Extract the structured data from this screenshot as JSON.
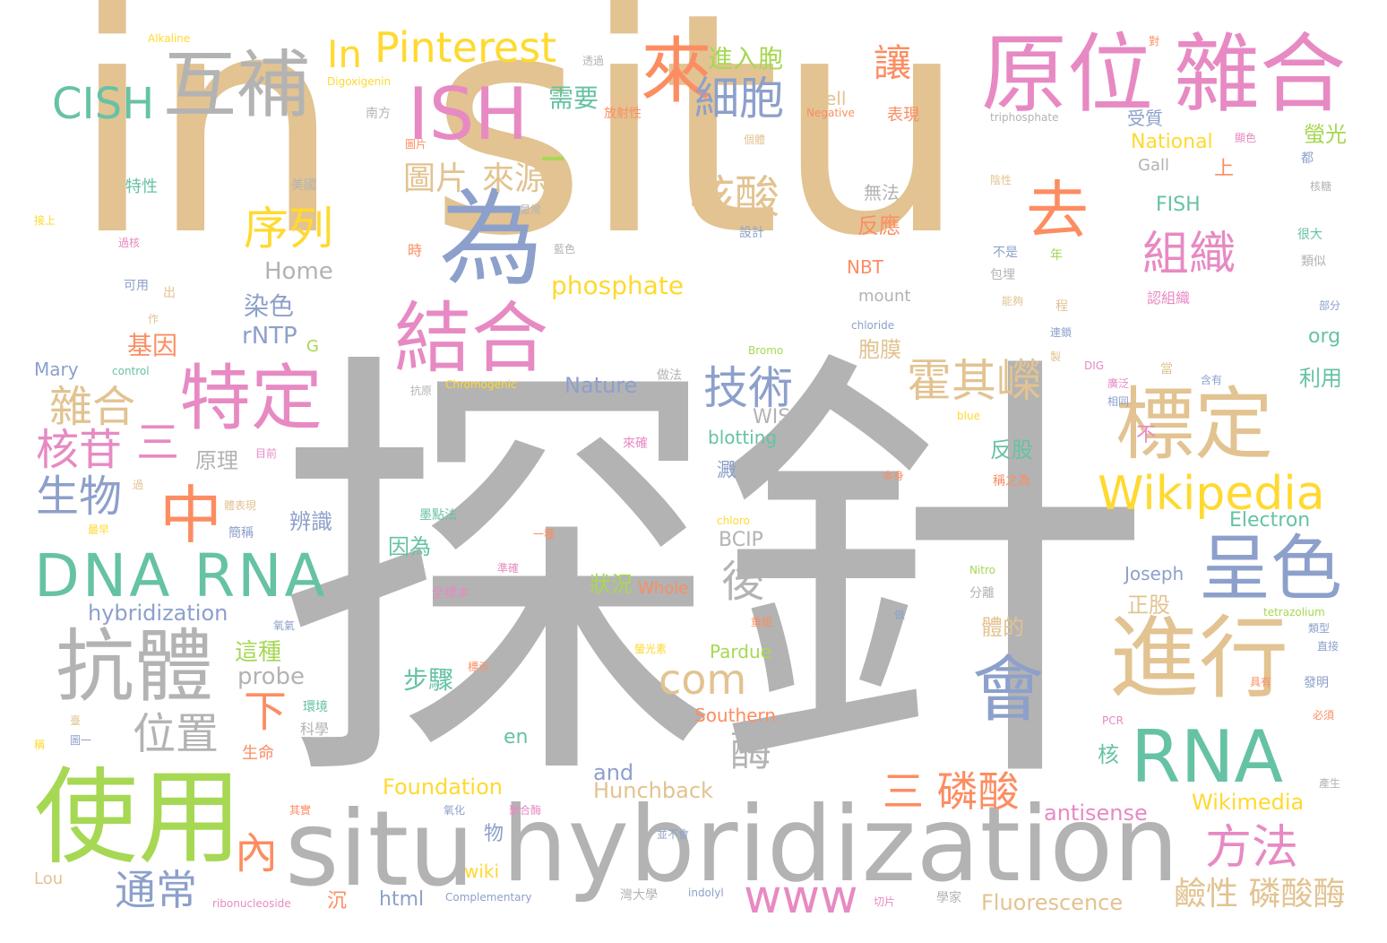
{
  "palette": {
    "tan": "#e2c391",
    "grey": "#b3b3b3",
    "pink": "#e78ac3",
    "green": "#66c2a5",
    "orange": "#fc8d62",
    "blue": "#8da0cb",
    "yellow": "#ffd92f",
    "lime": "#a6d854"
  },
  "words": [
    {
      "text": "in situ",
      "color": "#e2c391"
    },
    {
      "text": "探針",
      "color": "#b3b3b3"
    },
    {
      "text": "原位",
      "color": "#e78ac3"
    },
    {
      "text": "雜合",
      "color": "#e78ac3"
    },
    {
      "text": "互補",
      "color": "#b3b3b3"
    },
    {
      "text": "ISH",
      "color": "#e78ac3"
    },
    {
      "text": "為",
      "color": "#8da0cb"
    },
    {
      "text": "來",
      "color": "#fc8d62"
    },
    {
      "text": "結合",
      "color": "#e78ac3"
    },
    {
      "text": "特定",
      "color": "#e78ac3"
    },
    {
      "text": "中",
      "color": "#fc8d62"
    },
    {
      "text": "DNA RNA",
      "color": "#66c2a5"
    },
    {
      "text": "抗體",
      "color": "#b3b3b3"
    },
    {
      "text": "使用",
      "color": "#a6d854"
    },
    {
      "text": "situ",
      "color": "#b3b3b3"
    },
    {
      "text": "hybridization",
      "color": "#b3b3b3"
    },
    {
      "text": "進行",
      "color": "#e2c391"
    },
    {
      "text": "標定",
      "color": "#e2c391"
    },
    {
      "text": "呈色",
      "color": "#8da0cb"
    },
    {
      "text": "RNA",
      "color": "#66c2a5"
    },
    {
      "text": "會",
      "color": "#8da0cb"
    },
    {
      "text": "Wikipedia",
      "color": "#ffd92f"
    },
    {
      "text": "Pinterest",
      "color": "#ffd92f"
    },
    {
      "text": "CISH",
      "color": "#66c2a5"
    },
    {
      "text": "細胞",
      "color": "#8da0cb"
    },
    {
      "text": "核酸",
      "color": "#e2c391"
    },
    {
      "text": "組織",
      "color": "#e78ac3"
    },
    {
      "text": "去",
      "color": "#fc8d62"
    },
    {
      "text": "序列",
      "color": "#ffd92f"
    },
    {
      "text": "圖片",
      "color": "#e2c391"
    },
    {
      "text": "來源",
      "color": "#e2c391"
    },
    {
      "text": "技術",
      "color": "#8da0cb"
    },
    {
      "text": "霍其嶸",
      "color": "#e2c391"
    },
    {
      "text": "雜合",
      "color": "#e2c391"
    },
    {
      "text": "核苷",
      "color": "#e78ac3"
    },
    {
      "text": "生物",
      "color": "#8da0cb"
    },
    {
      "text": "位置",
      "color": "#b3b3b3"
    },
    {
      "text": "com",
      "color": "#e2c391"
    },
    {
      "text": "方法",
      "color": "#e78ac3"
    },
    {
      "text": "三 磷酸",
      "color": "#fc8d62"
    },
    {
      "text": "通常",
      "color": "#8da0cb"
    },
    {
      "text": "www",
      "color": "#e78ac3"
    },
    {
      "text": "鹼性 磷酸酶",
      "color": "#e2c391"
    },
    {
      "text": "後",
      "color": "#b3b3b3"
    },
    {
      "text": "酶",
      "color": "#b3b3b3"
    },
    {
      "text": "In",
      "color": "#ffd92f"
    },
    {
      "text": "讓",
      "color": "#fc8d62"
    },
    {
      "text": "需要",
      "color": "#66c2a5"
    },
    {
      "text": "進入胞",
      "color": "#a6d854"
    },
    {
      "text": "phosphate",
      "color": "#ffd92f"
    },
    {
      "text": "Home",
      "color": "#b3b3b3"
    },
    {
      "text": "染色",
      "color": "#8da0cb"
    },
    {
      "text": "rNTP",
      "color": "#8da0cb"
    },
    {
      "text": "基因",
      "color": "#fc8d62"
    },
    {
      "text": "三",
      "color": "#e78ac3"
    },
    {
      "text": "原理",
      "color": "#b3b3b3"
    },
    {
      "text": "下",
      "color": "#fc8d62"
    },
    {
      "text": "內",
      "color": "#fc8d62"
    },
    {
      "text": "probe",
      "color": "#b3b3b3"
    },
    {
      "text": "這種",
      "color": "#a6d854"
    },
    {
      "text": "步驟",
      "color": "#66c2a5"
    },
    {
      "text": "Foundation",
      "color": "#ffd92f"
    },
    {
      "text": "wiki",
      "color": "#ffd92f"
    },
    {
      "text": "html",
      "color": "#8da0cb"
    },
    {
      "text": "Fluorescence",
      "color": "#e2c391"
    },
    {
      "text": "Wikimedia",
      "color": "#ffd92f"
    },
    {
      "text": "antisense",
      "color": "#e78ac3"
    },
    {
      "text": "Southern",
      "color": "#fc8d62"
    },
    {
      "text": "Hunchback",
      "color": "#e2c391"
    },
    {
      "text": "and",
      "color": "#8da0cb"
    },
    {
      "text": "en",
      "color": "#66c2a5"
    },
    {
      "text": "hybridization",
      "color": "#8da0cb"
    },
    {
      "text": "Mary",
      "color": "#8da0cb"
    },
    {
      "text": "Nature",
      "color": "#8da0cb"
    },
    {
      "text": "WISH",
      "color": "#b3b3b3"
    },
    {
      "text": "blotting",
      "color": "#66c2a5"
    },
    {
      "text": "BCIP",
      "color": "#b3b3b3"
    },
    {
      "text": "Joseph",
      "color": "#8da0cb"
    },
    {
      "text": "Pardue",
      "color": "#a6d854"
    },
    {
      "text": "Electron",
      "color": "#66c2a5"
    },
    {
      "text": "National",
      "color": "#ffd92f"
    },
    {
      "text": "Gall",
      "color": "#b3b3b3"
    },
    {
      "text": "FISH",
      "color": "#66c2a5"
    },
    {
      "text": "NBT",
      "color": "#fc8d62"
    },
    {
      "text": "mount",
      "color": "#b3b3b3"
    },
    {
      "text": "cell",
      "color": "#e2c391"
    },
    {
      "text": "org",
      "color": "#66c2a5"
    },
    {
      "text": "胞膜",
      "color": "#e2c391"
    },
    {
      "text": "反應",
      "color": "#fc8d62"
    },
    {
      "text": "無法",
      "color": "#b3b3b3"
    },
    {
      "text": "反股",
      "color": "#66c2a5"
    },
    {
      "text": "正股",
      "color": "#e2c391"
    },
    {
      "text": "體的",
      "color": "#e2c391"
    },
    {
      "text": "辨識",
      "color": "#8da0cb"
    },
    {
      "text": "因為",
      "color": "#66c2a5"
    },
    {
      "text": "狀況",
      "color": "#a6d854"
    },
    {
      "text": "Whole",
      "color": "#fc8d62"
    },
    {
      "text": "利用",
      "color": "#66c2a5"
    },
    {
      "text": "螢光",
      "color": "#a6d854"
    },
    {
      "text": "受質",
      "color": "#8da0cb"
    },
    {
      "text": "上",
      "color": "#fc8d62"
    },
    {
      "text": "表現",
      "color": "#fc8d62"
    },
    {
      "text": "不",
      "color": "#e78ac3"
    },
    {
      "text": "核",
      "color": "#66c2a5"
    },
    {
      "text": "物",
      "color": "#8da0cb"
    },
    {
      "text": "沉",
      "color": "#fc8d62"
    },
    {
      "text": "澱",
      "color": "#8da0cb"
    },
    {
      "text": "生命",
      "color": "#fc8d62"
    },
    {
      "text": "科學",
      "color": "#b3b3b3"
    },
    {
      "text": "環境",
      "color": "#66c2a5"
    },
    {
      "text": "特性",
      "color": "#66c2a5"
    },
    {
      "text": "可用",
      "color": "#8da0cb"
    },
    {
      "text": "出",
      "color": "#e2c391"
    },
    {
      "text": "美國",
      "color": "#b3b3b3"
    },
    {
      "text": "南方",
      "color": "#b3b3b3"
    },
    {
      "text": "放射性",
      "color": "#fc8d62"
    },
    {
      "text": "Alkaline",
      "color": "#ffd92f"
    },
    {
      "text": "Digoxigenin",
      "color": "#ffd92f"
    },
    {
      "text": "Negative",
      "color": "#fc8d62"
    },
    {
      "text": "triphosphate",
      "color": "#b3b3b3"
    },
    {
      "text": "Bromo",
      "color": "#a6d854"
    },
    {
      "text": "chloride",
      "color": "#8da0cb"
    },
    {
      "text": "control",
      "color": "#66c2a5"
    },
    {
      "text": "Chromogenic",
      "color": "#ffd92f"
    },
    {
      "text": "blue",
      "color": "#ffd92f"
    },
    {
      "text": "DIG",
      "color": "#e78ac3"
    },
    {
      "text": "chloro",
      "color": "#ffd92f"
    },
    {
      "text": "Nitro",
      "color": "#a6d854"
    },
    {
      "text": "tetrazolium",
      "color": "#a6d854"
    },
    {
      "text": "PCR",
      "color": "#e78ac3"
    },
    {
      "text": "Complementary",
      "color": "#8da0cb"
    },
    {
      "text": "indolyl",
      "color": "#8da0cb"
    },
    {
      "text": "ribonucleoside",
      "color": "#e78ac3"
    },
    {
      "text": "Lou",
      "color": "#e2c391"
    },
    {
      "text": "G",
      "color": "#a6d854"
    },
    {
      "text": "墨點法",
      "color": "#66c2a5"
    },
    {
      "text": "全標本",
      "color": "#e78ac3"
    },
    {
      "text": "目前",
      "color": "#e78ac3"
    },
    {
      "text": "簡稱",
      "color": "#8da0cb"
    },
    {
      "text": "最早",
      "color": "#ffd92f"
    },
    {
      "text": "過",
      "color": "#e2c391"
    },
    {
      "text": "體表現",
      "color": "#e2c391"
    },
    {
      "text": "氧氣",
      "color": "#8da0cb"
    },
    {
      "text": "標示",
      "color": "#fc8d62"
    },
    {
      "text": "準確",
      "color": "#e78ac3"
    },
    {
      "text": "一種",
      "color": "#fc8d62"
    },
    {
      "text": "來確",
      "color": "#e78ac3"
    },
    {
      "text": "螢光素",
      "color": "#ffd92f"
    },
    {
      "text": "重組",
      "color": "#fc8d62"
    },
    {
      "text": "做法",
      "color": "#b3b3b3"
    },
    {
      "text": "本身",
      "color": "#fc8d62"
    },
    {
      "text": "稱之為",
      "color": "#fc8d62"
    },
    {
      "text": "分離",
      "color": "#b3b3b3"
    },
    {
      "text": "做",
      "color": "#8da0cb"
    },
    {
      "text": "故常",
      "color": "#b3b3b3"
    },
    {
      "text": "切片",
      "color": "#e78ac3"
    },
    {
      "text": "學家",
      "color": "#b3b3b3"
    },
    {
      "text": "灣大學",
      "color": "#b3b3b3"
    },
    {
      "text": "並不會",
      "color": "#8da0cb"
    },
    {
      "text": "聚合酶",
      "color": "#e78ac3"
    },
    {
      "text": "氧化",
      "color": "#8da0cb"
    },
    {
      "text": "其實",
      "color": "#fc8d62"
    },
    {
      "text": "稱",
      "color": "#ffd92f"
    },
    {
      "text": "圖一",
      "color": "#8da0cb"
    },
    {
      "text": "臺",
      "color": "#e2c391"
    },
    {
      "text": "抗原",
      "color": "#b3b3b3"
    },
    {
      "text": "透過",
      "color": "#b3b3b3"
    },
    {
      "text": "圖片",
      "color": "#fc8d62"
    },
    {
      "text": "最常",
      "color": "#b3b3b3"
    },
    {
      "text": "藍色",
      "color": "#b3b3b3"
    },
    {
      "text": "設計",
      "color": "#8da0cb"
    },
    {
      "text": "個體",
      "color": "#e2c391"
    },
    {
      "text": "陰性",
      "color": "#e2c391"
    },
    {
      "text": "時",
      "color": "#fc8d62"
    },
    {
      "text": "不是",
      "color": "#8da0cb"
    },
    {
      "text": "年",
      "color": "#a6d854"
    },
    {
      "text": "包埋",
      "color": "#b3b3b3"
    },
    {
      "text": "能夠",
      "color": "#e2c391"
    },
    {
      "text": "程",
      "color": "#e2c391"
    },
    {
      "text": "連鎖",
      "color": "#8da0cb"
    },
    {
      "text": "製",
      "color": "#e2c391"
    },
    {
      "text": "當",
      "color": "#e2c391"
    },
    {
      "text": "含有",
      "color": "#8da0cb"
    },
    {
      "text": "廣泛",
      "color": "#e78ac3"
    },
    {
      "text": "相同",
      "color": "#8da0cb"
    },
    {
      "text": "顯色",
      "color": "#e78ac3"
    },
    {
      "text": "都",
      "color": "#8da0cb"
    },
    {
      "text": "核糖",
      "color": "#b3b3b3"
    },
    {
      "text": "很大",
      "color": "#66c2a5"
    },
    {
      "text": "類似",
      "color": "#b3b3b3"
    },
    {
      "text": "部分",
      "color": "#8da0cb"
    },
    {
      "text": "認組織",
      "color": "#e78ac3"
    },
    {
      "text": "類型",
      "color": "#8da0cb"
    },
    {
      "text": "直接",
      "color": "#8da0cb"
    },
    {
      "text": "具有",
      "color": "#fc8d62"
    },
    {
      "text": "發明",
      "color": "#8da0cb"
    },
    {
      "text": "必須",
      "color": "#fc8d62"
    },
    {
      "text": "產生",
      "color": "#b3b3b3"
    },
    {
      "text": "對",
      "color": "#fc8d62"
    },
    {
      "text": "接上",
      "color": "#ffd92f"
    },
    {
      "text": "過核",
      "color": "#e78ac3"
    },
    {
      "text": "作",
      "color": "#e2c391"
    }
  ]
}
